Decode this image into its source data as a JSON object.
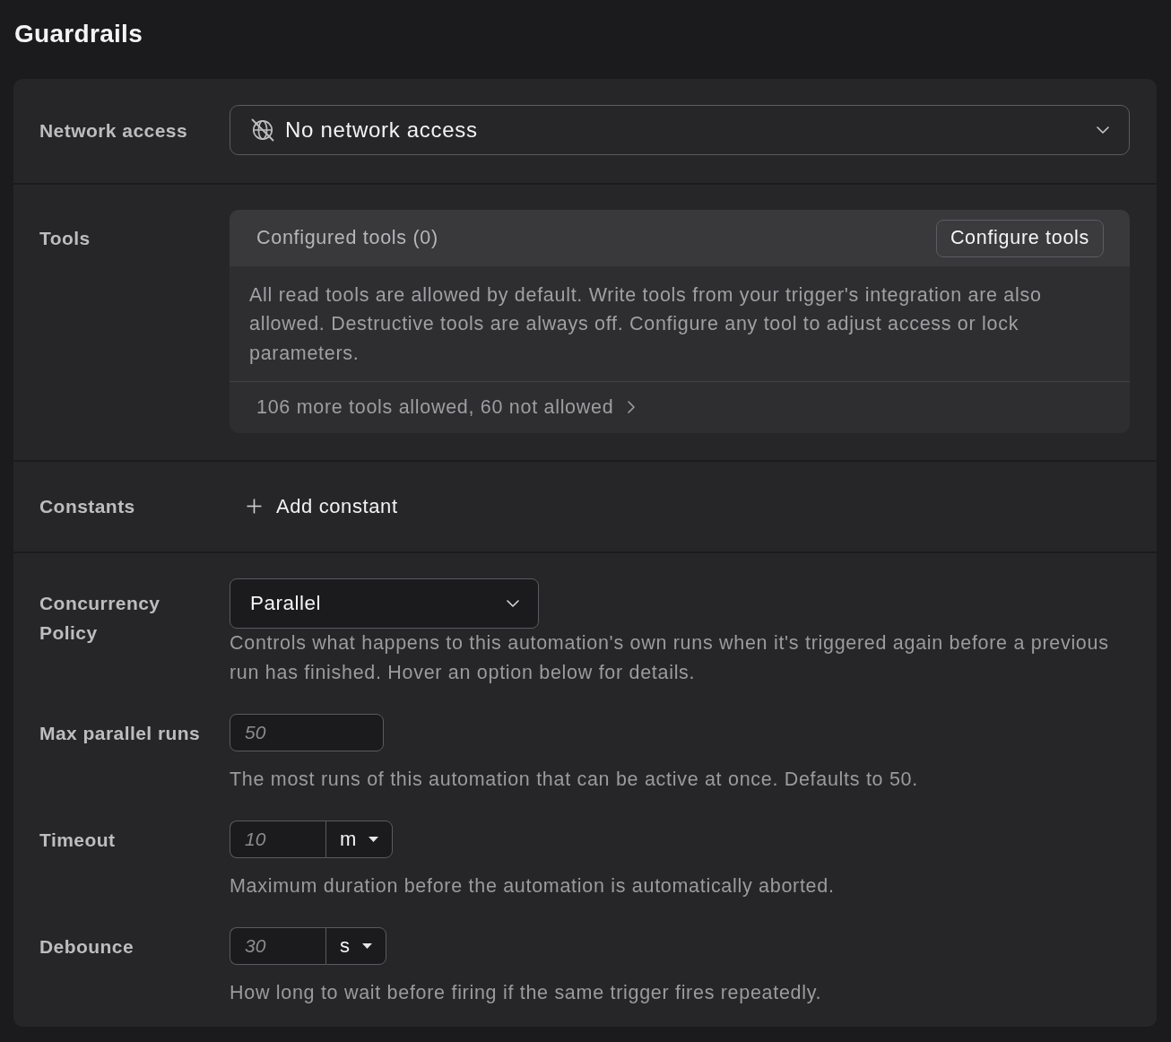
{
  "title": "Guardrails",
  "network_access": {
    "label": "Network access",
    "value": "No network access"
  },
  "tools": {
    "label": "Tools",
    "header": "Configured tools (0)",
    "button": "Configure tools",
    "description": "All read tools are allowed by default. Write tools from your trigger's integration are also allowed. Destructive tools are always off. Configure any tool to adjust access or lock parameters.",
    "summary": "106 more tools allowed, 60 not allowed"
  },
  "constants": {
    "label": "Constants",
    "button": "Add constant"
  },
  "run_settings": [
    {
      "kind": "select",
      "label": "Concurrency Policy",
      "value": "Parallel",
      "help": "Controls what happens to this automation's own runs when it's triggered again before a previous run has finished. Hover an option below for details."
    },
    {
      "kind": "number",
      "label": "Max parallel runs",
      "placeholder": "50",
      "help": "The most runs of this automation that can be active at once. Defaults to 50."
    },
    {
      "kind": "duration",
      "label": "Timeout",
      "placeholder": "10",
      "unit": "m",
      "help": "Maximum duration before the automation is automatically aborted."
    },
    {
      "kind": "duration",
      "label": "Debounce",
      "placeholder": "30",
      "unit": "s",
      "help": "How long to wait before firing if the same trigger fires repeatedly."
    }
  ]
}
